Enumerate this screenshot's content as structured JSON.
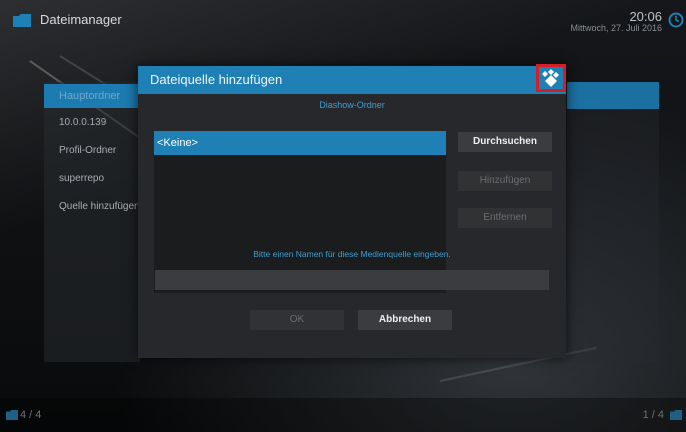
{
  "header": {
    "title": "Dateimanager",
    "time": "20:06",
    "date": "Mittwoch, 27. Juli 2016"
  },
  "sidebar": {
    "items": [
      {
        "label": "Hauptordner"
      },
      {
        "label": "10.0.0.139"
      },
      {
        "label": "Profil-Ordner"
      },
      {
        "label": "superrepo"
      },
      {
        "label": "Quelle hinzufügen"
      }
    ]
  },
  "dialog": {
    "title": "Dateiquelle hinzufügen",
    "subtitle": "Diashow-Ordner",
    "list": [
      {
        "label": "<Keine>"
      }
    ],
    "buttons": {
      "browse": "Durchsuchen",
      "add": "Hinzufügen",
      "remove": "Entfernen",
      "ok": "OK",
      "cancel": "Abbrechen"
    },
    "hint": "Bitte einen Namen für diese Medienquelle eingeben.",
    "name_value": ""
  },
  "footer": {
    "left_count": "4 / 4",
    "right_count": "1 / 4"
  },
  "colors": {
    "accent": "#1f80b5",
    "highlight_border": "#d32027"
  },
  "icons": {
    "header": "folder-icon",
    "clock": "clock-icon",
    "dialog": "kodi-logo-icon"
  }
}
